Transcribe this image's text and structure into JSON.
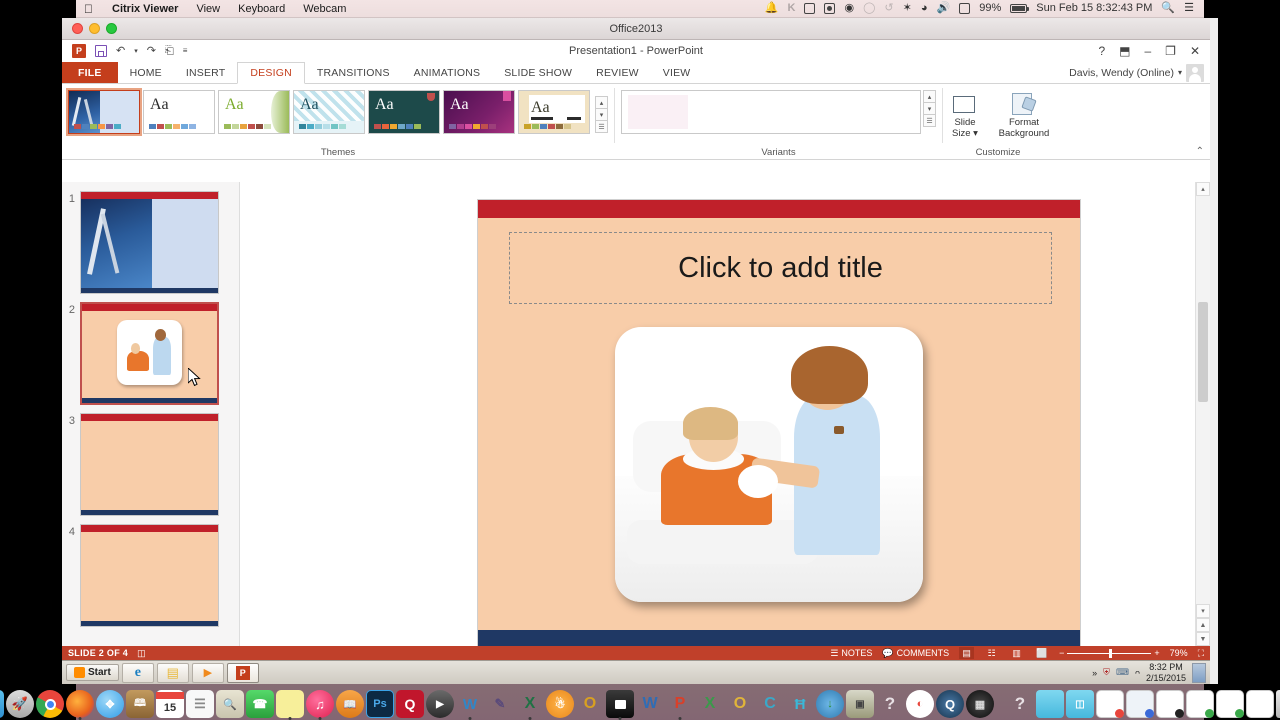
{
  "mac_menubar": {
    "apple": "apple-logo",
    "items": [
      {
        "label": "Citrix Viewer",
        "bold": true
      },
      {
        "label": "View",
        "bold": false
      },
      {
        "label": "Keyboard",
        "bold": false
      },
      {
        "label": "Webcam",
        "bold": false
      }
    ],
    "status_items": [
      {
        "name": "notification-bell-icon",
        "glyph": "\u0001"
      },
      {
        "name": "kaspersky-icon",
        "glyph": "K"
      },
      {
        "name": "device-icon",
        "glyph": "\u0001"
      },
      {
        "name": "airplay-icon",
        "glyph": "\u0001"
      },
      {
        "name": "record-icon",
        "glyph": "\u0001"
      },
      {
        "name": "chat-bubble-icon",
        "glyph": "\u0001"
      },
      {
        "name": "timemachine-icon",
        "glyph": "\u0001"
      },
      {
        "name": "bluetooth-icon",
        "glyph": "\u0001"
      },
      {
        "name": "wifi-icon",
        "glyph": "\u0001"
      },
      {
        "name": "volume-icon",
        "glyph": "\u0001"
      },
      {
        "name": "input-source-icon",
        "glyph": "\u0001"
      }
    ],
    "battery_percent": "99%",
    "datetime": "Sun Feb 15  8:32:43 PM",
    "search": "search-icon",
    "notification_center": "list-icon"
  },
  "citrix_window": {
    "title": "Office2013"
  },
  "powerpoint": {
    "title": "Presentation1 - PowerPoint",
    "quick_access": [
      {
        "name": "powerpoint-logo-icon",
        "label": "P"
      },
      {
        "name": "save-icon",
        "label": ""
      },
      {
        "name": "undo-icon",
        "label": "↶"
      },
      {
        "name": "undo-dropdown-icon",
        "label": "▾"
      },
      {
        "name": "redo-icon",
        "label": "↷"
      },
      {
        "name": "start-presentation-icon",
        "label": "⏵"
      },
      {
        "name": "customize-qat-icon",
        "label": "≡"
      }
    ],
    "window_controls": [
      {
        "name": "help-button",
        "label": "?"
      },
      {
        "name": "ribbon-display-options-button",
        "label": "⬒"
      },
      {
        "name": "minimize-button",
        "label": "–"
      },
      {
        "name": "restore-button",
        "label": "❐"
      },
      {
        "name": "close-button",
        "label": "✕"
      }
    ],
    "tabs": [
      {
        "label": "FILE",
        "kind": "file"
      },
      {
        "label": "HOME",
        "kind": "normal"
      },
      {
        "label": "INSERT",
        "kind": "normal"
      },
      {
        "label": "DESIGN",
        "kind": "active"
      },
      {
        "label": "TRANSITIONS",
        "kind": "normal"
      },
      {
        "label": "ANIMATIONS",
        "kind": "normal"
      },
      {
        "label": "SLIDE SHOW",
        "kind": "normal"
      },
      {
        "label": "REVIEW",
        "kind": "normal"
      },
      {
        "label": "VIEW",
        "kind": "normal"
      }
    ],
    "account": {
      "name": "Davis, Wendy (Online)",
      "dropdown": "▾"
    },
    "ribbon": {
      "groups": [
        {
          "name": "themes",
          "label": "Themes"
        },
        {
          "name": "variants",
          "label": "Variants"
        },
        {
          "name": "customize",
          "label": "Customize"
        }
      ],
      "themes": [
        {
          "name": "theme-facet-selected",
          "aa": "",
          "selected": true,
          "bg": "#1d3f70",
          "text": "#ffffff",
          "swatches": [
            "#c0504d",
            "#4f81bd",
            "#9bbb59",
            "#f79646",
            "#8064a2",
            "#4bacc6"
          ]
        },
        {
          "name": "theme-office",
          "aa": "Aa",
          "selected": false,
          "bg": "#ffffff",
          "text": "#2b2b2b",
          "swatches": [
            "#4f81bd",
            "#c0504d",
            "#9bbb59",
            "#f6b26b",
            "#6fa8dc",
            "#8eb4e3"
          ]
        },
        {
          "name": "theme-organic",
          "aa": "Aa",
          "selected": false,
          "bg": "#ffffff",
          "text": "#7aab2b",
          "swatches": [
            "#9bbb59",
            "#c3d69b",
            "#e8a33d",
            "#c0504d",
            "#8c4b3c",
            "#d6e3bc"
          ]
        },
        {
          "name": "theme-wisp",
          "aa": "Aa",
          "selected": false,
          "bg": "#e4f1f6",
          "text": "#2b4b5b",
          "swatches": [
            "#31859c",
            "#4bacc6",
            "#92cddc",
            "#b7dee8",
            "#70c4c4",
            "#a6dcd6"
          ]
        },
        {
          "name": "theme-slice",
          "aa": "Aa",
          "selected": false,
          "bg": "#1e4a4a",
          "text": "#ffffff",
          "swatches": [
            "#c0504d",
            "#e8643c",
            "#f0a830",
            "#6fa8c8",
            "#4f81bd",
            "#9bbb59"
          ]
        },
        {
          "name": "theme-berlin",
          "aa": "Aa",
          "selected": false,
          "bg": "#3d1440",
          "text": "#ffffff",
          "swatches": [
            "#8064a2",
            "#b23f8f",
            "#d94fa0",
            "#f0a830",
            "#c0504d",
            "#9c3f7a"
          ]
        },
        {
          "name": "theme-ion",
          "aa": "Aa",
          "selected": false,
          "bg": "#f5e6c8",
          "text": "#3a3a2a",
          "swatches": [
            "#c9a227",
            "#9bbb59",
            "#4f81bd",
            "#c0504d",
            "#8c6b3c",
            "#d6c48c"
          ]
        }
      ],
      "gallery_scroll": [
        {
          "name": "themes-scroll-up-button",
          "glyph": "▴"
        },
        {
          "name": "themes-scroll-down-button",
          "glyph": "▾"
        },
        {
          "name": "themes-more-button",
          "glyph": "☰"
        }
      ],
      "variants_scroll": [
        {
          "name": "variants-scroll-up-button",
          "glyph": "▴"
        },
        {
          "name": "variants-scroll-down-button",
          "glyph": "▾"
        },
        {
          "name": "variants-more-button",
          "glyph": "☰"
        }
      ],
      "customize_buttons": [
        {
          "name": "slide-size-button",
          "line1": "Slide",
          "line2": "Size ▾"
        },
        {
          "name": "format-background-button",
          "line1": "Format",
          "line2": "Background"
        }
      ],
      "collapse_ribbon": "⌃"
    },
    "slides": [
      {
        "number": "1",
        "selected": false,
        "kind": "photo-coaster-blue"
      },
      {
        "number": "2",
        "selected": true,
        "kind": "photo-nurse"
      },
      {
        "number": "3",
        "selected": false,
        "kind": "blank"
      },
      {
        "number": "4",
        "selected": false,
        "kind": "blank"
      }
    ],
    "slide_canvas": {
      "title_placeholder": "Click to add title",
      "image_alt": "nurse-and-patient-photo",
      "accent_top": "#c0202a",
      "accent_bottom": "#1f3864",
      "background": "#f8cda9"
    },
    "status_bar": {
      "slide_indicator": "SLIDE 2 OF 4",
      "language_icon": "notes-page-icon",
      "notes_label": "NOTES",
      "comments_label": "COMMENTS",
      "view_buttons": [
        {
          "name": "normal-view-button",
          "glyph": "▤",
          "active": true
        },
        {
          "name": "slide-sorter-view-button",
          "glyph": "☷",
          "active": false
        },
        {
          "name": "reading-view-button",
          "glyph": "▥",
          "active": false
        },
        {
          "name": "slide-show-button",
          "glyph": "⬜",
          "active": false
        }
      ],
      "zoom_out": "−",
      "zoom_in": "+",
      "zoom_level": "79%",
      "fit_slide": "⛶"
    }
  },
  "windows_taskbar": {
    "start_label": "Start",
    "buttons": [
      {
        "name": "taskbar-internet-explorer",
        "glyph": "e",
        "color": "#1a7fc1",
        "active": false
      },
      {
        "name": "taskbar-file-explorer",
        "glyph": "▤",
        "color": "#e8b83a",
        "active": false
      },
      {
        "name": "taskbar-media-player",
        "glyph": "▶",
        "color": "#f08a1c",
        "active": false
      },
      {
        "name": "taskbar-powerpoint",
        "glyph": "P",
        "color": "#c43e1c",
        "active": true
      }
    ],
    "tray": {
      "expand": "»",
      "icons": [
        {
          "name": "tray-antivirus-icon",
          "glyph": "⛨"
        },
        {
          "name": "tray-network-icon",
          "glyph": "⌨"
        },
        {
          "name": "tray-volume-icon",
          "glyph": "ᴖ"
        }
      ],
      "time": "8:32 PM",
      "date": "2/15/2015",
      "show_desktop": "show-desktop-button"
    }
  },
  "mac_dock": {
    "items": [
      {
        "name": "dock-finder",
        "glyph": "☺",
        "bg": "#3ba6e8",
        "running": true
      },
      {
        "name": "dock-launchpad",
        "glyph": "◉",
        "bg": "#c9c9c9",
        "running": false
      },
      {
        "name": "dock-chrome",
        "glyph": "●",
        "bg": "#37a34a",
        "running": false
      },
      {
        "name": "dock-firefox",
        "glyph": "◕",
        "bg": "#e8611c",
        "running": true
      },
      {
        "name": "dock-safari",
        "glyph": "✧",
        "bg": "#2f9ce8",
        "running": false
      },
      {
        "name": "dock-contacts",
        "glyph": "▤",
        "bg": "#a9762f",
        "running": false
      },
      {
        "name": "dock-calendar",
        "glyph": "15",
        "bg": "#ffffff",
        "running": false
      },
      {
        "name": "dock-reminders",
        "glyph": "≡",
        "bg": "#f4f4f4",
        "running": false
      },
      {
        "name": "dock-notes-search",
        "glyph": "✎",
        "bg": "#d8d8c8",
        "running": false
      },
      {
        "name": "dock-facetime",
        "glyph": "☎",
        "bg": "#3ec14d",
        "running": false
      },
      {
        "name": "dock-stickies",
        "glyph": "▭",
        "bg": "#f5e87a",
        "running": true
      },
      {
        "name": "dock-itunes",
        "glyph": "♫",
        "bg": "#ef3f6e",
        "running": true
      },
      {
        "name": "dock-ibooks",
        "glyph": "◐",
        "bg": "#e8913a",
        "running": false
      },
      {
        "name": "dock-photoshop",
        "glyph": "Ps",
        "bg": "#0c2a44",
        "running": false
      },
      {
        "name": "dock-quark",
        "glyph": "Q",
        "bg": "#c1162c",
        "running": false
      },
      {
        "name": "dock-quicktime",
        "glyph": "▶",
        "bg": "#4a4a4a",
        "running": false
      },
      {
        "name": "dock-wolfram",
        "glyph": "W",
        "bg": "#2f87c8",
        "running": true
      },
      {
        "name": "dock-sketch",
        "glyph": "✎",
        "bg": "#7c6a9a",
        "running": false
      },
      {
        "name": "dock-pen",
        "glyph": "✒",
        "bg": "#5a6a8a",
        "running": false
      },
      {
        "name": "dock-excel",
        "glyph": "X",
        "bg": "#1f7244",
        "running": true
      },
      {
        "name": "dock-access",
        "glyph": "☸",
        "bg": "#e8871c",
        "running": false
      },
      {
        "name": "dock-outlook-old",
        "glyph": "O",
        "bg": "#e8b83a",
        "running": false
      },
      {
        "name": "dock-ipod",
        "glyph": "▯",
        "bg": "#2b2b2b",
        "running": true
      },
      {
        "name": "dock-word",
        "glyph": "W",
        "bg": "#2b5797",
        "running": false
      },
      {
        "name": "dock-powerpoint",
        "glyph": "P",
        "bg": "#c43e1c",
        "running": true
      },
      {
        "name": "dock-excel-2",
        "glyph": "X",
        "bg": "#1f7244",
        "running": false
      },
      {
        "name": "dock-outlook",
        "glyph": "O",
        "bg": "#d8a021",
        "running": false
      },
      {
        "name": "dock-onenote",
        "glyph": "C",
        "bg": "#2f9cbf",
        "running": false
      },
      {
        "name": "dock-messenger",
        "glyph": "Ħ",
        "bg": "#3aa8c8",
        "running": false
      },
      {
        "name": "dock-downloads-globe",
        "glyph": "↓",
        "bg": "#3a8f3a",
        "running": false
      },
      {
        "name": "dock-screenshot",
        "glyph": "▣",
        "bg": "#9a9a6a",
        "running": false
      },
      {
        "name": "dock-unknown-1",
        "glyph": "?",
        "bg": "transparent",
        "running": false
      },
      {
        "name": "dock-teamviewer",
        "glyph": "◔",
        "bg": "#ffffff",
        "running": false
      },
      {
        "name": "dock-quicktime-2",
        "glyph": "Q",
        "bg": "#2b4a6a",
        "running": false
      },
      {
        "name": "dock-parallels",
        "glyph": "⊞",
        "bg": "#1a1a1a",
        "running": false
      }
    ],
    "right_items": [
      {
        "name": "dock-unknown-2",
        "glyph": "?",
        "bg": "transparent"
      },
      {
        "name": "dock-folder-1",
        "glyph": "▧",
        "bg": "#5bc8e8"
      },
      {
        "name": "dock-folder-2",
        "glyph": "▧",
        "bg": "#5bc8e8"
      },
      {
        "name": "dock-document-1",
        "glyph": "▤",
        "bg": "#ffffff"
      },
      {
        "name": "dock-document-2",
        "glyph": "▤",
        "bg": "#eef3f8"
      },
      {
        "name": "dock-document-3",
        "glyph": "▬",
        "bg": "#ffffff"
      },
      {
        "name": "dock-document-4",
        "glyph": "▤",
        "bg": "#ffffff"
      },
      {
        "name": "dock-document-5",
        "glyph": "▤",
        "bg": "#ffffff"
      },
      {
        "name": "dock-document-6",
        "glyph": "▤",
        "bg": "#ffffff"
      },
      {
        "name": "dock-trash",
        "glyph": "Ὕ1",
        "bg": "#d8d8d8"
      }
    ]
  }
}
